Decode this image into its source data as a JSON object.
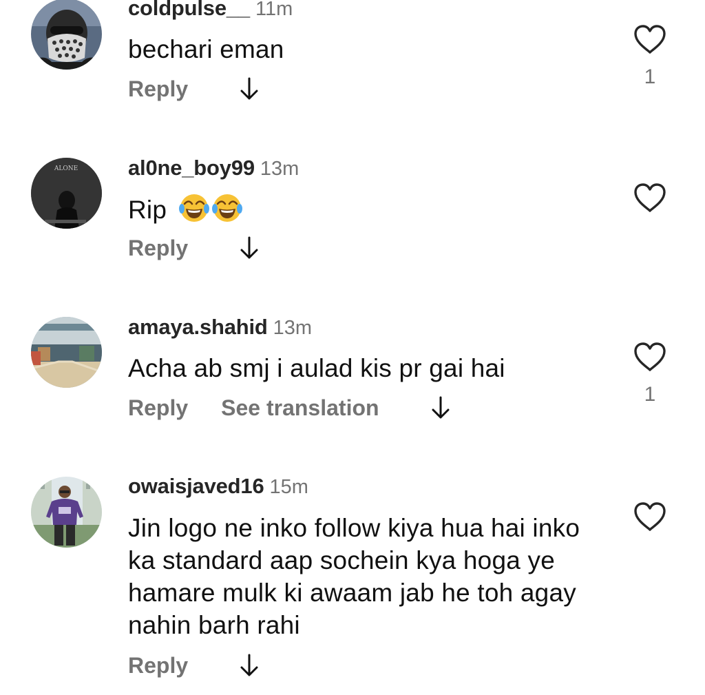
{
  "comments": [
    {
      "username": "coldpulse__",
      "time": "11m",
      "text": "bechari eman",
      "reply_label": "Reply",
      "likes": "1",
      "avatar_icon": "masked-person-avatar",
      "heart_icon": "heart-outline-icon",
      "down_icon": "arrow-down-icon"
    },
    {
      "username": "al0ne_boy99",
      "time": "13m",
      "text": "Rip",
      "emojis": [
        "face-with-tears-of-joy",
        "face-with-tears-of-joy"
      ],
      "reply_label": "Reply",
      "likes": "",
      "avatar_icon": "dark-alone-avatar",
      "avatar_text": "ALONE",
      "heart_icon": "heart-outline-icon",
      "down_icon": "arrow-down-icon"
    },
    {
      "username": "amaya.shahid",
      "time": "13m",
      "text": "Acha ab smj i aulad kis pr gai hai",
      "reply_label": "Reply",
      "translate_label": "See translation",
      "likes": "1",
      "avatar_icon": "indoor-hall-avatar",
      "heart_icon": "heart-outline-icon",
      "down_icon": "arrow-down-icon"
    },
    {
      "username": "owaisjaved16",
      "time": "15m",
      "text": "Jin logo ne inko follow kiya hua hai inko ka standard aap sochein kya hoga ye hamare mulk ki awaam jab he toh agay nahin barh rahi",
      "reply_label": "Reply",
      "likes": "",
      "avatar_icon": "person-purple-shirt-avatar",
      "heart_icon": "heart-outline-icon",
      "down_icon": "arrow-down-icon"
    }
  ],
  "colors": {
    "username": "#262626",
    "secondary": "#737373",
    "text": "#111111",
    "background": "#ffffff"
  }
}
